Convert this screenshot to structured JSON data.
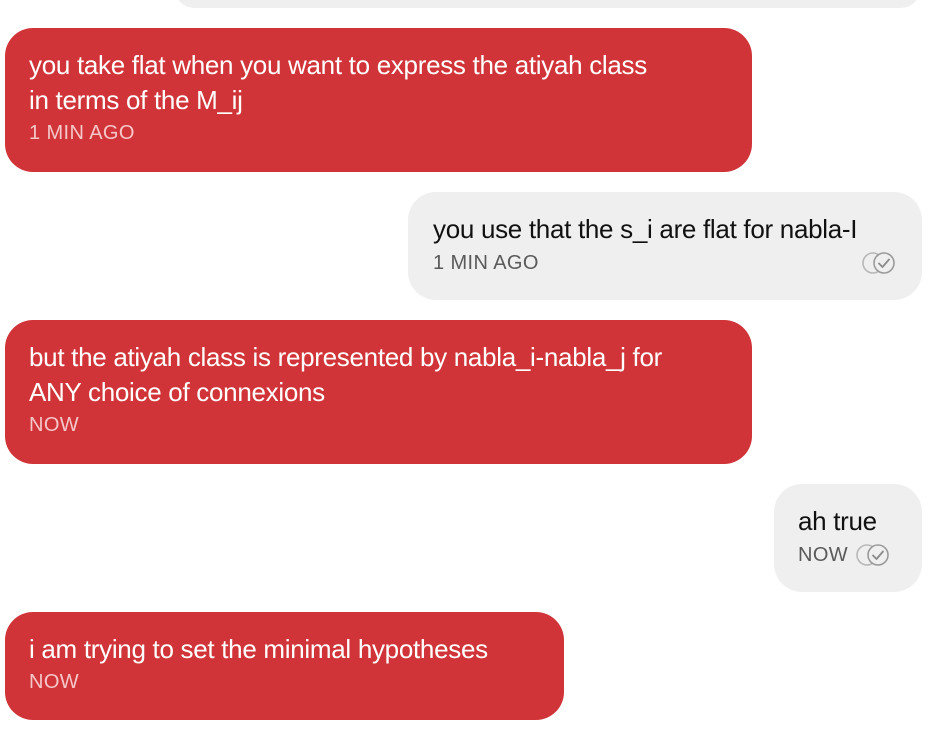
{
  "colors": {
    "incoming_bg": "#d13438",
    "outgoing_bg": "#efefef",
    "incoming_time": "#f4c7c8",
    "outgoing_time": "#5a5a5a"
  },
  "messages": [
    {
      "direction": "incoming",
      "text": "you take flat when you want to express the atiyah class\nin terms of the M_ij",
      "time": "1 MIN AGO"
    },
    {
      "direction": "outgoing",
      "text": "you use that the s_i are flat for nabla-I",
      "time": "1 MIN AGO",
      "status_icon": "read-check-icon"
    },
    {
      "direction": "incoming",
      "text": "but the atiyah class is represented by nabla_i-nabla_j for\nANY choice of connexions",
      "time": "NOW"
    },
    {
      "direction": "outgoing",
      "text": "ah true",
      "time": "NOW",
      "status_icon": "read-check-icon"
    },
    {
      "direction": "incoming",
      "text": "i am trying to set the minimal hypotheses",
      "time": "NOW"
    }
  ]
}
